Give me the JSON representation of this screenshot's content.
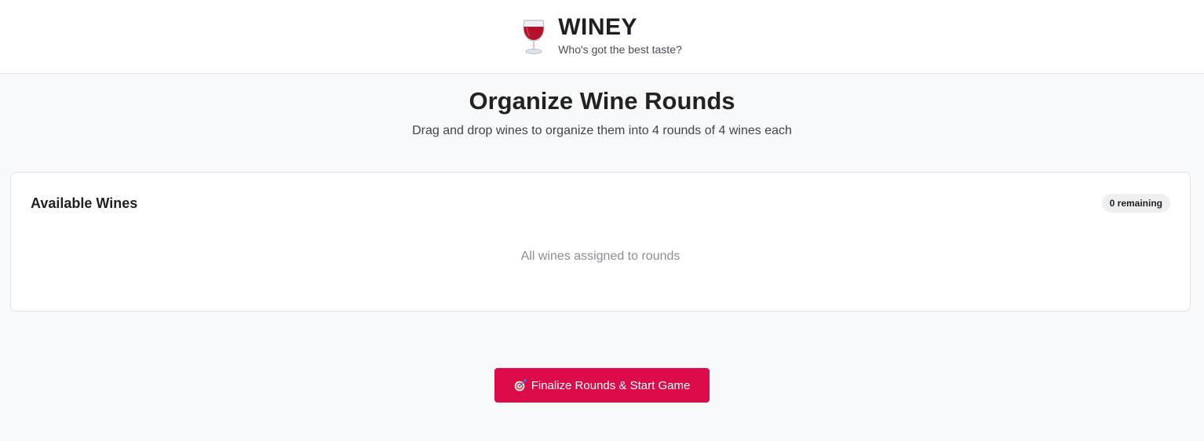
{
  "app": {
    "icon": "wine-glass-icon",
    "title": "WINEY",
    "tagline": "Who's got the best taste?"
  },
  "page": {
    "title": "Organize Wine Rounds",
    "subtitle": "Drag and drop wines to organize them into 4 rounds of 4 wines each"
  },
  "available_wines": {
    "heading": "Available Wines",
    "remaining_badge": "0 remaining",
    "empty_message": "All wines assigned to rounds"
  },
  "actions": {
    "finalize_icon": "target-icon",
    "finalize_label": "Finalize Rounds & Start Game"
  },
  "colors": {
    "accent": "#dc0b4a",
    "background": "#f8f9fa",
    "wine": "#b3122a"
  }
}
